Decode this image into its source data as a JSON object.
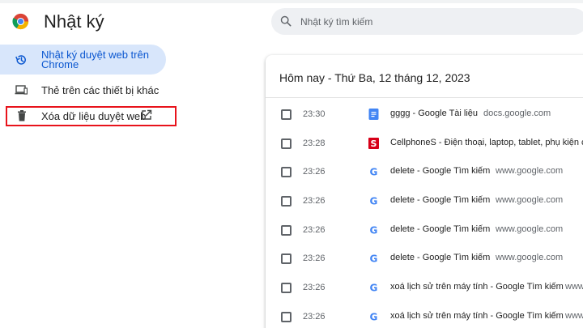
{
  "header": {
    "logo_icon": "chrome-logo-icon",
    "title": "Nhật ký"
  },
  "search": {
    "icon": "search-icon",
    "placeholder": "Nhật ký tìm kiếm"
  },
  "sidebar": {
    "items": [
      {
        "icon": "history-icon",
        "label": "Nhật ký duyệt web trên Chrome",
        "selected": true
      },
      {
        "icon": "devices-icon",
        "label": "Thẻ trên các thiết bị khác",
        "selected": false
      },
      {
        "icon": "trash-icon",
        "label": "Xóa dữ liệu duyệt web",
        "external_icon": "open-in-new-icon",
        "selected": false
      }
    ]
  },
  "colors": {
    "accent": "#0b57d0",
    "selected_bg": "#d8e6fb",
    "highlight": "#e8131b"
  },
  "history": {
    "heading": "Hôm nay - Thứ Ba, 12 tháng 12, 2023",
    "entries": [
      {
        "time": "23:30",
        "favicon": "google-docs-icon",
        "title": "gggg - Google Tài liệu",
        "domain": "docs.google.com"
      },
      {
        "time": "23:28",
        "favicon": "cellphones-icon",
        "title": "CellphoneS - Điện thoại, laptop, tablet, phụ kiện chính hãng",
        "domain": ""
      },
      {
        "time": "23:26",
        "favicon": "google-icon",
        "title": "delete - Google Tìm kiếm",
        "domain": "www.google.com"
      },
      {
        "time": "23:26",
        "favicon": "google-icon",
        "title": "delete - Google Tìm kiếm",
        "domain": "www.google.com"
      },
      {
        "time": "23:26",
        "favicon": "google-icon",
        "title": "delete - Google Tìm kiếm",
        "domain": "www.google.com"
      },
      {
        "time": "23:26",
        "favicon": "google-icon",
        "title": "delete - Google Tìm kiếm",
        "domain": "www.google.com"
      },
      {
        "time": "23:26",
        "favicon": "google-icon",
        "title": "xoá lịch sử trên máy tính - Google Tìm kiếm",
        "domain": "www.google.com"
      },
      {
        "time": "23:26",
        "favicon": "google-icon",
        "title": "xoá lịch sử trên máy tính - Google Tìm kiếm",
        "domain": "www.google.com"
      }
    ]
  }
}
